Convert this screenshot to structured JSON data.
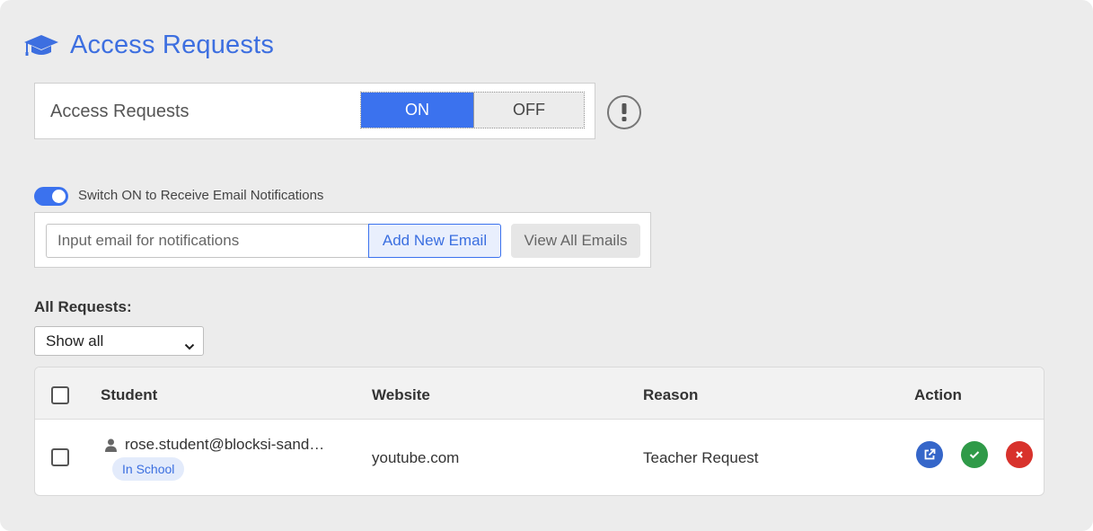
{
  "header": {
    "title": "Access Requests",
    "icon": "graduation-cap-icon"
  },
  "access_requests": {
    "label": "Access Requests",
    "on_label": "ON",
    "off_label": "OFF",
    "selected": "ON",
    "info_icon": "exclamation-icon"
  },
  "email_notifications": {
    "toggle_label": "Switch ON to Receive Email Notifications",
    "toggle_on": true,
    "input_placeholder": "Input email for notifications",
    "add_label": "Add New Email",
    "view_label": "View All Emails"
  },
  "filter": {
    "heading": "All Requests:",
    "selected": "Show all"
  },
  "table": {
    "headers": {
      "student": "Student",
      "website": "Website",
      "reason": "Reason",
      "action": "Action"
    },
    "rows": [
      {
        "student": "rose.student@blocksi-sand…",
        "badge": "In School",
        "website": "youtube.com",
        "reason": "Teacher Request"
      }
    ]
  },
  "colors": {
    "accent": "#3b72ee",
    "approve": "#2f9a48",
    "deny": "#d8322c",
    "open": "#3566c9"
  }
}
